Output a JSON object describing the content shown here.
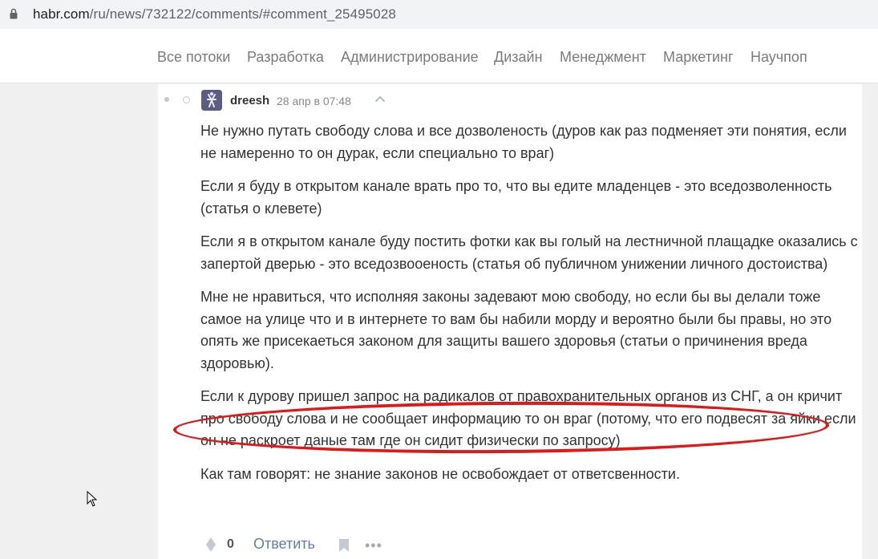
{
  "browser": {
    "url_main": "habr.com",
    "url_rest": "/ru/news/732122/comments/#comment_25495028"
  },
  "nav": {
    "items": [
      "Все потоки",
      "Разработка",
      "Администрирование",
      "Дизайн",
      "Менеджмент",
      "Маркетинг",
      "Научпоп"
    ]
  },
  "comment": {
    "author": "dreesh",
    "time": "28 апр в 07:48",
    "paragraphs": [
      "Не нужно путать свободу слова и все дозволеность (дуров как раз подменяет эти понятия, если не намеренно то он дурак, если специально то враг)",
      "Если я буду в открытом канале врать про то, что вы едите младенцев - это вседозволенность (статья о клевете)",
      "Если я в открытом канале буду постить фотки как вы голый на лестничной плащадке оказались с запертой дверью - это вседозвооеность (статья об публичном унижении личного достоиства)",
      "Мне не нравиться, что исполняя законы задевают мою свободу, но если бы вы делали тоже самое на улице что и в интернете то вам бы набили морду и вероятно были бы правы, но это опять же присекаеться законом для защиты вашего здоровья (статьи о причинения вреда здоровью).",
      "Если к дурову пришел запрос на радикалов от правохранительных органов из СНГ, а он кричит про свободу слова и не сообщает информацию то он враг (потому, что его подвесят за яйки если он не раскроет даные там где он сидит физически по запросу)",
      "Как там говорят: не знание законов не освобождает от ответсвенности."
    ],
    "score": "0",
    "reply_label": "Ответить",
    "more_label": "•••"
  },
  "colors": {
    "highlight": "#e01818",
    "link": "#5e7fa6"
  }
}
